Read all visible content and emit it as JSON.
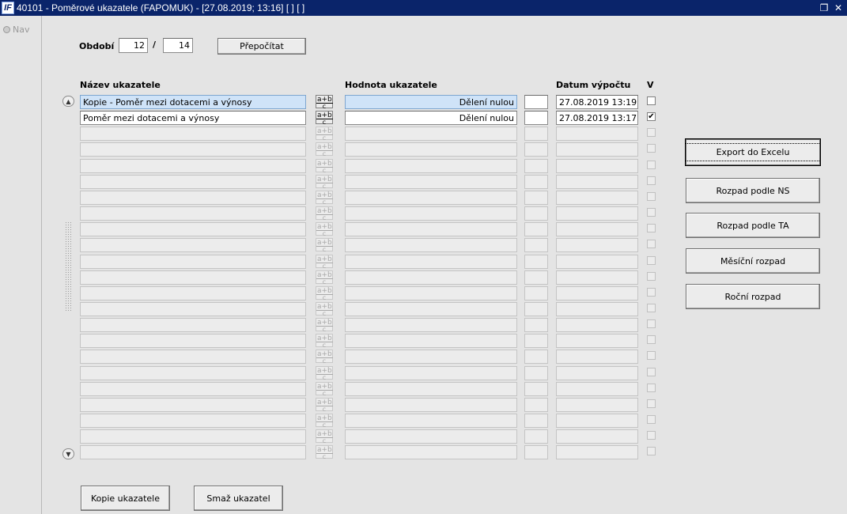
{
  "window": {
    "title": "40101 - Poměrové ukazatele (FAPOMUK) - [27.08.2019; 13:16]  [ ]  [ ]",
    "icon_label": "IF"
  },
  "nav": {
    "label": "Nav"
  },
  "period": {
    "label": "Období",
    "from": "12",
    "separator": "/",
    "to": "14",
    "recalc_button": "Přepočítat"
  },
  "columns": {
    "name": "Název ukazatele",
    "value": "Hodnota ukazatele",
    "date": "Datum výpočtu",
    "v": "V"
  },
  "formula_icon": {
    "num": "a+b",
    "den": "c"
  },
  "rows": [
    {
      "name": "Kopie - Poměr mezi dotacemi a výnosy",
      "value": "Dělení nulou",
      "extra": "",
      "date": "27.08.2019 13:19",
      "v": "",
      "selected": true,
      "enabled": true
    },
    {
      "name": "Poměr mezi dotacemi a výnosy",
      "value": "Dělení nulou",
      "extra": "",
      "date": "27.08.2019 13:17",
      "v": "✔",
      "selected": false,
      "enabled": true
    },
    {
      "name": "",
      "value": "",
      "extra": "",
      "date": "",
      "v": "",
      "enabled": false
    },
    {
      "name": "",
      "value": "",
      "extra": "",
      "date": "",
      "v": "",
      "enabled": false
    },
    {
      "name": "",
      "value": "",
      "extra": "",
      "date": "",
      "v": "",
      "enabled": false
    },
    {
      "name": "",
      "value": "",
      "extra": "",
      "date": "",
      "v": "",
      "enabled": false
    },
    {
      "name": "",
      "value": "",
      "extra": "",
      "date": "",
      "v": "",
      "enabled": false
    },
    {
      "name": "",
      "value": "",
      "extra": "",
      "date": "",
      "v": "",
      "enabled": false
    },
    {
      "name": "",
      "value": "",
      "extra": "",
      "date": "",
      "v": "",
      "enabled": false
    },
    {
      "name": "",
      "value": "",
      "extra": "",
      "date": "",
      "v": "",
      "enabled": false
    },
    {
      "name": "",
      "value": "",
      "extra": "",
      "date": "",
      "v": "",
      "enabled": false
    },
    {
      "name": "",
      "value": "",
      "extra": "",
      "date": "",
      "v": "",
      "enabled": false
    },
    {
      "name": "",
      "value": "",
      "extra": "",
      "date": "",
      "v": "",
      "enabled": false
    },
    {
      "name": "",
      "value": "",
      "extra": "",
      "date": "",
      "v": "",
      "enabled": false
    },
    {
      "name": "",
      "value": "",
      "extra": "",
      "date": "",
      "v": "",
      "enabled": false
    },
    {
      "name": "",
      "value": "",
      "extra": "",
      "date": "",
      "v": "",
      "enabled": false
    },
    {
      "name": "",
      "value": "",
      "extra": "",
      "date": "",
      "v": "",
      "enabled": false
    },
    {
      "name": "",
      "value": "",
      "extra": "",
      "date": "",
      "v": "",
      "enabled": false
    },
    {
      "name": "",
      "value": "",
      "extra": "",
      "date": "",
      "v": "",
      "enabled": false
    },
    {
      "name": "",
      "value": "",
      "extra": "",
      "date": "",
      "v": "",
      "enabled": false
    },
    {
      "name": "",
      "value": "",
      "extra": "",
      "date": "",
      "v": "",
      "enabled": false
    },
    {
      "name": "",
      "value": "",
      "extra": "",
      "date": "",
      "v": "",
      "enabled": false
    },
    {
      "name": "",
      "value": "",
      "extra": "",
      "date": "",
      "v": "",
      "enabled": false
    }
  ],
  "side_buttons": [
    "Export do Excelu",
    "Rozpad podle NS",
    "Rozpad podle TA",
    "Měsíční rozpad",
    "Roční rozpad"
  ],
  "bottom_buttons": {
    "copy": "Kopie ukazatele",
    "delete": "Smaž ukazatel"
  }
}
